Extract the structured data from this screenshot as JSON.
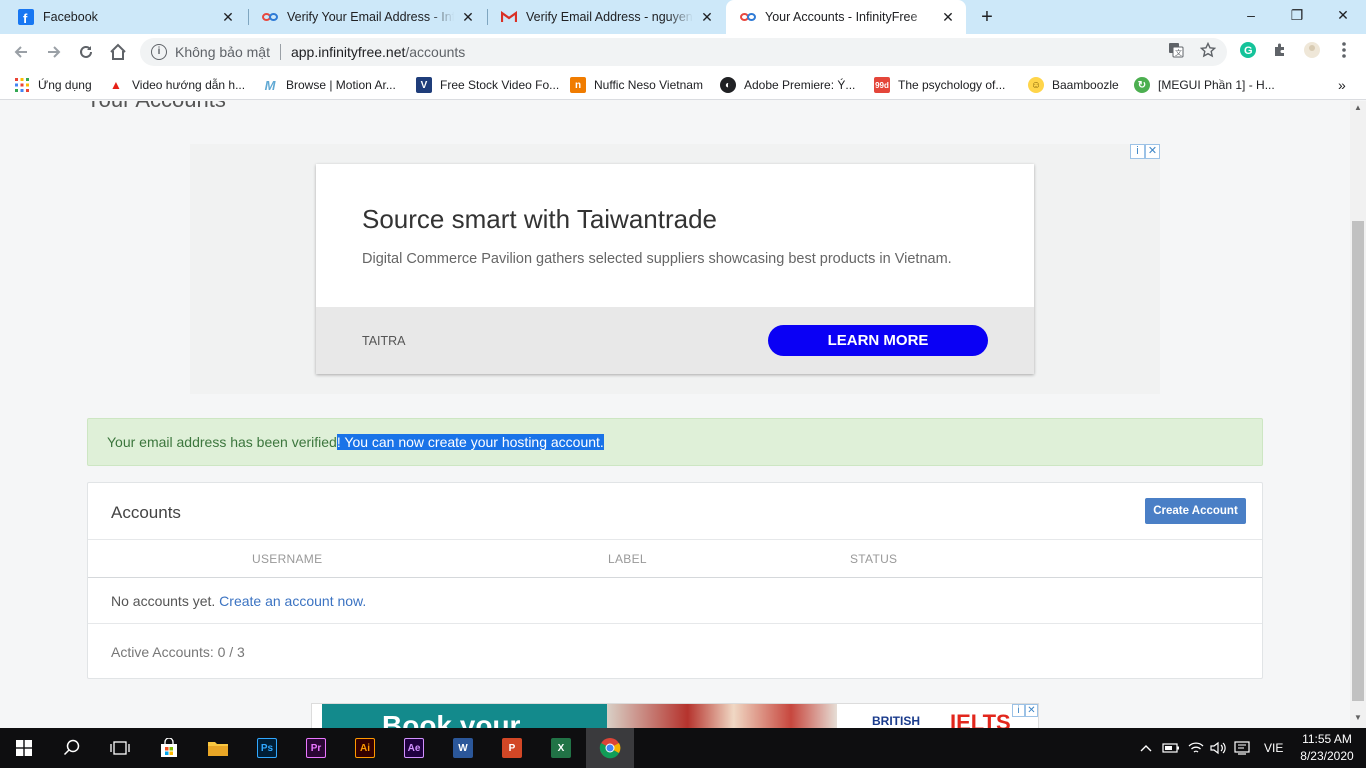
{
  "browser": {
    "tabs": [
      {
        "title": "Facebook",
        "icon": "facebook-icon"
      },
      {
        "title": "Verify Your Email Address - InfinityFree",
        "icon": "infinityfree-icon"
      },
      {
        "title": "Verify Email Address - nguyennhu",
        "icon": "gmail-icon"
      },
      {
        "title": "Your Accounts - InfinityFree",
        "icon": "infinityfree-icon"
      }
    ],
    "new_tab": "+",
    "window_controls": {
      "minimize": "–",
      "maximize": "❐",
      "close": "✕"
    },
    "address": {
      "security_label": "Không bảo mật",
      "host": "app.infinityfree.net",
      "path": "/accounts"
    },
    "bookmarks": [
      {
        "label": "Ứng dụng",
        "icon": "apps-grid-icon"
      },
      {
        "label": "Video hướng dẫn h...",
        "icon": "youtube-icon"
      },
      {
        "label": "Browse | Motion Ar...",
        "icon": "motion-array-icon"
      },
      {
        "label": "Free Stock Video Fo...",
        "icon": "videvo-icon"
      },
      {
        "label": "Nuffic Neso Vietnam",
        "icon": "nuffic-icon"
      },
      {
        "label": "Adobe Premiere: Ý...",
        "icon": "globe-icon"
      },
      {
        "label": "The psychology of...",
        "icon": "99designs-icon"
      },
      {
        "label": "Baamboozle",
        "icon": "baamboozle-icon"
      },
      {
        "label": "[MEGUI Phần 1] - H...",
        "icon": "megui-icon"
      }
    ],
    "bookmarks_overflow": "»"
  },
  "page": {
    "title": "Your Accounts",
    "ad_top": {
      "headline": "Source smart with Taiwantrade",
      "description": "Digital Commerce Pavilion gathers selected suppliers showcasing best products in Vietnam.",
      "advertiser": "TAITRA",
      "cta": "LEARN MORE",
      "cta_color": "#0a00f5"
    },
    "alert": {
      "text_before": "Your email address has been verified",
      "text_selected": "! You can now create your hosting account."
    },
    "accounts_panel": {
      "title": "Accounts",
      "create_button": "Create Account",
      "columns": [
        "USERNAME",
        "LABEL",
        "STATUS"
      ],
      "empty_text": "No accounts yet.",
      "empty_link": "Create an account now.",
      "active_accounts": "Active Accounts: 0 / 3"
    },
    "ad_bottom": {
      "headline": "Book your",
      "brand": "BRITISH",
      "product": "IELTS"
    }
  },
  "taskbar": {
    "apps": [
      {
        "name": "Ps",
        "color": "#31a8ff",
        "bg": "#001e36"
      },
      {
        "name": "Pr",
        "color": "#ea77ff",
        "bg": "#2a0634"
      },
      {
        "name": "Ai",
        "color": "#ff9a00",
        "bg": "#330000"
      },
      {
        "name": "Ae",
        "color": "#d291ff",
        "bg": "#1f0040"
      },
      {
        "name": "W",
        "color": "#ffffff",
        "bg": "#2b579a"
      },
      {
        "name": "P",
        "color": "#ffffff",
        "bg": "#d24726"
      },
      {
        "name": "X",
        "color": "#ffffff",
        "bg": "#217346"
      }
    ],
    "language": "VIE",
    "time": "11:55 AM",
    "date": "8/23/2020"
  }
}
